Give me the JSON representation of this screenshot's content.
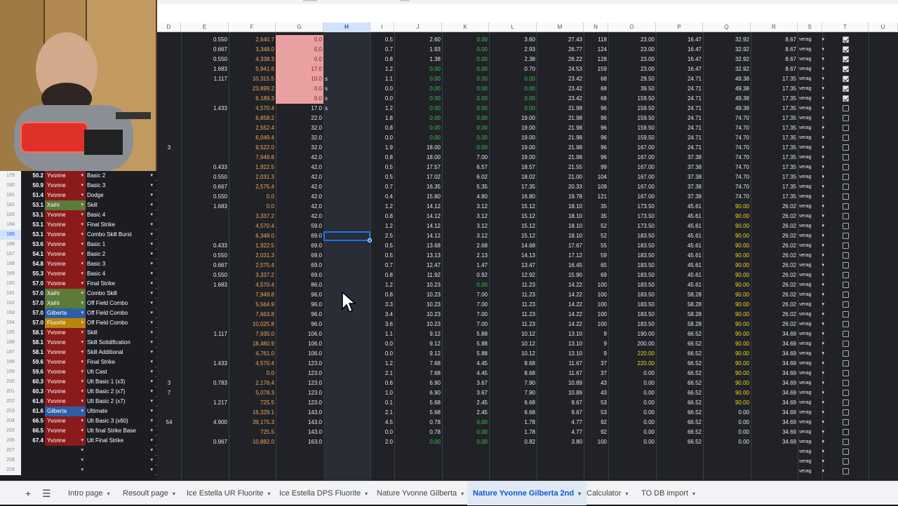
{
  "columns": [
    "D",
    "E",
    "F",
    "G",
    "H",
    "I",
    "J",
    "K",
    "L",
    "M",
    "N",
    "O",
    "P",
    "Q",
    "R",
    "S",
    "T",
    "U"
  ],
  "top_rows": [
    {
      "e": "0.550",
      "f": "2,640.7",
      "g": "0.0",
      "h": "",
      "i": "0.5",
      "j": "2.60",
      "k": "0.00",
      "l": "3.60",
      "m": "27.43",
      "n": "118",
      "o": "23.00",
      "p": "16.47",
      "q": "32.92",
      "r": "8.67",
      "t": true
    },
    {
      "e": "0.667",
      "f": "3,348.0",
      "g": "0.0",
      "h": "",
      "i": "0.7",
      "j": "1.93",
      "k": "0.00",
      "l": "2.93",
      "m": "26.77",
      "n": "124",
      "o": "23.00",
      "p": "16.47",
      "q": "32.92",
      "r": "8.67",
      "t": true
    },
    {
      "e": "0.550",
      "f": "4,338.3",
      "g": "0.0",
      "h": "",
      "i": "0.8",
      "j": "1.38",
      "k": "0.00",
      "l": "2.38",
      "m": "26.22",
      "n": "128",
      "o": "23.00",
      "p": "16.47",
      "q": "32.92",
      "r": "8.67",
      "t": true
    },
    {
      "e": "1.683",
      "f": "5,941.6",
      "g": "17.0",
      "h": "",
      "i": "1.2",
      "j": "0.00",
      "k": "0.00",
      "l": "0.70",
      "m": "24.53",
      "n": "159",
      "o": "23.00",
      "p": "16.47",
      "q": "32.92",
      "r": "8.67",
      "t": true
    },
    {
      "e": "1.117",
      "f": "10,315.5",
      "g": "10.0",
      "h": "s",
      "i": "1.1",
      "j": "0.00",
      "k": "0.00",
      "l": "0.00",
      "m": "23.42",
      "n": "68",
      "o": "29.50",
      "p": "24.71",
      "q": "49.38",
      "r": "17.35",
      "t": true
    },
    {
      "e": "",
      "f": "23,899.2",
      "g": "0.0",
      "h": "s",
      "i": "0.0",
      "j": "0.00",
      "k": "0.00",
      "l": "0.00",
      "m": "23.42",
      "n": "68",
      "o": "39.50",
      "p": "24.71",
      "q": "49.38",
      "r": "17.35",
      "t": true
    },
    {
      "e": "",
      "f": "6,189.3",
      "g": "0.0",
      "h": "s",
      "i": "0.0",
      "j": "0.00",
      "k": "0.00",
      "l": "0.00",
      "m": "23.42",
      "n": "68",
      "o": "159.50",
      "p": "24.71",
      "q": "49.38",
      "r": "17.35",
      "t": true
    },
    {
      "e": "1.433",
      "f": "4,570.4",
      "g": "17.0",
      "h": "s",
      "i": "1.2",
      "j": "0.00",
      "k": "0.00",
      "l": "0.00",
      "m": "21.98",
      "n": "96",
      "o": "159.50",
      "p": "24.71",
      "q": "49.38",
      "r": "17.35",
      "t": false
    },
    {
      "e": "",
      "f": "6,858.2",
      "g": "22.0",
      "h": "",
      "i": "1.8",
      "j": "0.00",
      "k": "0.00",
      "l": "19.00",
      "m": "21.98",
      "n": "96",
      "o": "159.50",
      "p": "24.71",
      "q": "74.70",
      "r": "17.35",
      "t": false
    },
    {
      "e": "",
      "f": "2,552.4",
      "g": "32.0",
      "h": "",
      "i": "0.8",
      "j": "0.00",
      "k": "0.00",
      "l": "19.00",
      "m": "21.98",
      "n": "96",
      "o": "159.50",
      "p": "24.71",
      "q": "74.70",
      "r": "17.35",
      "t": false
    },
    {
      "e": "",
      "f": "6,049.4",
      "g": "32.0",
      "h": "",
      "i": "0.0",
      "j": "0.00",
      "k": "0.00",
      "l": "19.00",
      "m": "21.98",
      "n": "96",
      "o": "159.50",
      "p": "24.71",
      "q": "74.70",
      "r": "17.35",
      "t": false
    },
    {
      "d": "3",
      "e": "",
      "f": "9,522.0",
      "g": "32.0",
      "h": "",
      "i": "1.9",
      "j": "18.00",
      "k": "0.00",
      "l": "19.00",
      "m": "21.98",
      "n": "96",
      "o": "167.00",
      "p": "24.71",
      "q": "74.70",
      "r": "17.35",
      "t": false
    },
    {
      "e": "",
      "f": "7,949.8",
      "g": "42.0",
      "h": "",
      "i": "0.8",
      "j": "18.00",
      "k": "7.00",
      "l": "19.00",
      "m": "21.98",
      "n": "96",
      "o": "167.00",
      "p": "37.38",
      "q": "74.70",
      "r": "17.35",
      "t": false
    },
    {
      "e": "0.433",
      "f": "1,922.5",
      "g": "42.0",
      "h": "",
      "i": "0.5",
      "j": "17.57",
      "k": "6.57",
      "l": "18.57",
      "m": "21.55",
      "n": "99",
      "o": "167.00",
      "p": "37.38",
      "q": "74.70",
      "r": "17.35",
      "t": false
    }
  ],
  "rows": [
    {
      "num": "179",
      "pct": "50.2",
      "char": "Yvonne",
      "skill": "Basic 2",
      "e": "0.550",
      "f": "2,031.3",
      "g": "42.0",
      "i": "0.5",
      "j": "17.02",
      "k": "6.02",
      "l": "18.02",
      "m": "21.00",
      "n": "104",
      "o": "167.00",
      "p": "37.38",
      "q": "74.70",
      "r": "17.35"
    },
    {
      "num": "180",
      "pct": "50.9",
      "char": "Yvonne",
      "skill": "Basic 3",
      "e": "0.667",
      "f": "2,575.4",
      "g": "42.0",
      "i": "0.7",
      "j": "16.35",
      "k": "5.35",
      "l": "17.35",
      "m": "20.33",
      "n": "109",
      "o": "167.00",
      "p": "37.38",
      "q": "74.70",
      "r": "17.35"
    },
    {
      "num": "181",
      "pct": "51.4",
      "char": "Yvonne",
      "skill": "Dodge",
      "e": "0.550",
      "f": "0.0",
      "g": "42.0",
      "i": "0.4",
      "j": "15.80",
      "k": "4.80",
      "l": "16.80",
      "m": "19.78",
      "n": "121",
      "o": "167.00",
      "p": "37.38",
      "q": "74.70",
      "r": "17.35"
    },
    {
      "num": "182",
      "pct": "53.1",
      "char": "Xaihi",
      "skill": "Skill",
      "e": "1.683",
      "f": "0.0",
      "g": "42.0",
      "i": "1.2",
      "j": "14.12",
      "k": "3.12",
      "l": "15.12",
      "m": "18.10",
      "n": "35",
      "o": "173.50",
      "p": "45.61",
      "q": "90.00",
      "r": "26.02"
    },
    {
      "num": "183",
      "pct": "53.1",
      "char": "Yvonne",
      "skill": "Basic 4",
      "e": "",
      "f": "3,337.2",
      "g": "42.0",
      "i": "0.8",
      "j": "14.12",
      "k": "3.12",
      "l": "15.12",
      "m": "18.10",
      "n": "35",
      "o": "173.50",
      "p": "45.61",
      "q": "90.00",
      "r": "26.02"
    },
    {
      "num": "184",
      "pct": "53.1",
      "char": "Yvonne",
      "skill": "Final Strike",
      "e": "",
      "f": "4,570.4",
      "g": "59.0",
      "i": "1.2",
      "j": "14.12",
      "k": "3.12",
      "l": "15.12",
      "m": "18.10",
      "n": "52",
      "o": "173.50",
      "p": "45.61",
      "q": "90.00",
      "r": "26.02"
    },
    {
      "num": "185",
      "pct": "53.1",
      "char": "Yvonne",
      "skill": "Combo Skill Burst",
      "e": "",
      "f": "6,348.0",
      "g": "69.0",
      "i": "2.5",
      "j": "14.12",
      "k": "3.12",
      "l": "15.12",
      "m": "18.10",
      "n": "52",
      "o": "183.50",
      "p": "45.61",
      "q": "90.00",
      "r": "26.02"
    },
    {
      "num": "186",
      "pct": "53.6",
      "char": "Yvonne",
      "skill": "Basic 1",
      "e": "0.433",
      "f": "1,922.5",
      "g": "69.0",
      "i": "0.5",
      "j": "13.68",
      "k": "2.68",
      "l": "14.68",
      "m": "17.67",
      "n": "55",
      "o": "183.50",
      "p": "45.61",
      "q": "90.00",
      "r": "26.02"
    },
    {
      "num": "187",
      "pct": "54.1",
      "char": "Yvonne",
      "skill": "Basic 2",
      "e": "0.550",
      "f": "2,031.3",
      "g": "69.0",
      "i": "0.5",
      "j": "13.13",
      "k": "2.13",
      "l": "14.13",
      "m": "17.12",
      "n": "59",
      "o": "183.50",
      "p": "45.61",
      "q": "90.00",
      "r": "26.02"
    },
    {
      "num": "188",
      "pct": "54.8",
      "char": "Yvonne",
      "skill": "Basic 3",
      "e": "0.667",
      "f": "2,575.4",
      "g": "69.0",
      "i": "0.7",
      "j": "12.47",
      "k": "1.47",
      "l": "13.47",
      "m": "16.45",
      "n": "65",
      "o": "183.50",
      "p": "45.61",
      "q": "90.00",
      "r": "26.02"
    },
    {
      "num": "189",
      "pct": "55.3",
      "char": "Yvonne",
      "skill": "Basic 4",
      "e": "0.550",
      "f": "3,337.2",
      "g": "69.0",
      "i": "0.8",
      "j": "11.92",
      "k": "0.92",
      "l": "12.92",
      "m": "15.90",
      "n": "69",
      "o": "183.50",
      "p": "45.61",
      "q": "90.00",
      "r": "26.02"
    },
    {
      "num": "190",
      "pct": "57.0",
      "char": "Yvonne",
      "skill": "Final Strike",
      "e": "1.683",
      "f": "4,570.4",
      "g": "86.0",
      "i": "1.2",
      "j": "10.23",
      "k": "0.00",
      "l": "11.23",
      "m": "14.22",
      "n": "100",
      "o": "183.50",
      "p": "45.61",
      "q": "90.00",
      "r": "26.02"
    },
    {
      "num": "191",
      "pct": "57.0",
      "char": "Xaihi",
      "skill": "Combo Skill",
      "e": "",
      "f": "7,949.8",
      "g": "96.0",
      "i": "0.8",
      "j": "10.23",
      "k": "7.00",
      "l": "11.23",
      "m": "14.22",
      "n": "100",
      "o": "183.50",
      "p": "58.28",
      "q": "90.00",
      "r": "26.02"
    },
    {
      "num": "192",
      "pct": "57.0",
      "char": "Xaihi",
      "skill": "Off Field Combo",
      "e": "",
      "f": "5,564.9",
      "g": "96.0",
      "i": "3.3",
      "j": "10.23",
      "k": "7.00",
      "l": "11.23",
      "m": "14.22",
      "n": "100",
      "o": "183.50",
      "p": "58.28",
      "q": "90.00",
      "r": "26.02"
    },
    {
      "num": "193",
      "pct": "57.0",
      "char": "Gilberta",
      "skill": "Off Field Combo",
      "e": "",
      "f": "7,663.8",
      "g": "96.0",
      "i": "3.4",
      "j": "10.23",
      "k": "7.00",
      "l": "11.23",
      "m": "14.22",
      "n": "100",
      "o": "183.50",
      "p": "58.28",
      "q": "90.00",
      "r": "26.02"
    },
    {
      "num": "194",
      "pct": "57.0",
      "char": "Fluorite",
      "skill": "Off Field Combo",
      "e": "",
      "f": "10,025.8",
      "g": "96.0",
      "i": "3.6",
      "j": "10.23",
      "k": "7.00",
      "l": "11.23",
      "m": "14.22",
      "n": "100",
      "o": "183.50",
      "p": "58.28",
      "q": "90.00",
      "r": "26.02"
    },
    {
      "num": "195",
      "pct": "58.1",
      "char": "Yvonne",
      "skill": "Skill",
      "e": "1.117",
      "f": "7,935.0",
      "g": "106.0",
      "i": "1.1",
      "j": "9.12",
      "k": "5.88",
      "l": "10.12",
      "m": "13.10",
      "n": "9",
      "o": "190.00",
      "p": "66.52",
      "q": "90.00",
      "r": "34.69"
    },
    {
      "num": "196",
      "pct": "58.1",
      "char": "Yvonne",
      "skill": "Skill Solidification",
      "e": "",
      "f": "18,460.9",
      "g": "106.0",
      "i": "0.0",
      "j": "9.12",
      "k": "5.88",
      "l": "10.12",
      "m": "13.10",
      "n": "9",
      "o": "200.00",
      "p": "66.52",
      "q": "90.00",
      "r": "34.69"
    },
    {
      "num": "197",
      "pct": "58.1",
      "char": "Yvonne",
      "skill": "Skill Additional",
      "e": "",
      "f": "4,761.0",
      "g": "106.0",
      "i": "0.0",
      "j": "9.12",
      "k": "5.88",
      "l": "10.12",
      "m": "13.10",
      "n": "9",
      "o": "220.00",
      "p": "66.52",
      "q": "90.00",
      "r": "34.69"
    },
    {
      "num": "198",
      "pct": "59.6",
      "char": "Yvonne",
      "skill": "Final Strike",
      "e": "1.433",
      "f": "4,570.4",
      "g": "123.0",
      "i": "1.2",
      "j": "7.68",
      "k": "4.45",
      "l": "8.68",
      "m": "11.67",
      "n": "37",
      "o": "220.00",
      "p": "66.52",
      "q": "90.00",
      "r": "34.69"
    },
    {
      "num": "199",
      "pct": "59.6",
      "char": "Yvonne",
      "skill": "Ult Cast",
      "e": "",
      "f": "0.0",
      "g": "123.0",
      "i": "2.1",
      "j": "7.68",
      "k": "4.45",
      "l": "8.68",
      "m": "11.67",
      "n": "37",
      "o": "0.00",
      "p": "66.52",
      "q": "90.00",
      "r": "34.69"
    },
    {
      "num": "200",
      "pct": "60.3",
      "char": "Yvonne",
      "skill": "Ult Basic 1 (x3)",
      "d": "3",
      "e": "0.783",
      "f": "2,176.4",
      "g": "123.0",
      "i": "0.6",
      "j": "6.90",
      "k": "3.67",
      "l": "7.90",
      "m": "10.89",
      "n": "43",
      "o": "0.00",
      "p": "66.52",
      "q": "90.00",
      "r": "34.69"
    },
    {
      "num": "201",
      "pct": "60.3",
      "char": "Yvonne",
      "skill": "Ult Basic 2 (x7)",
      "d": "7",
      "e": "",
      "f": "5,078.3",
      "g": "123.0",
      "i": "1.0",
      "j": "6.90",
      "k": "3.67",
      "l": "7.90",
      "m": "10.89",
      "n": "43",
      "o": "0.00",
      "p": "66.52",
      "q": "90.00",
      "r": "34.69"
    },
    {
      "num": "202",
      "pct": "61.6",
      "char": "Yvonne",
      "skill": "Ult Basic 2 (x7)",
      "e": "1.217",
      "f": "725.5",
      "g": "123.0",
      "i": "0.1",
      "j": "5.68",
      "k": "2.45",
      "l": "6.68",
      "m": "9.67",
      "n": "53",
      "o": "0.00",
      "p": "66.52",
      "q": "90.00",
      "r": "34.69"
    },
    {
      "num": "203",
      "pct": "61.6",
      "char": "Gilberta",
      "skill": "Ultimate",
      "e": "",
      "f": "16,329.1",
      "g": "143.0",
      "i": "2.1",
      "j": "5.68",
      "k": "2.45",
      "l": "6.68",
      "m": "9.67",
      "n": "53",
      "o": "0.00",
      "p": "66.52",
      "q": "0.00",
      "r": "34.69"
    },
    {
      "num": "204",
      "pct": "66.5",
      "char": "Yvonne",
      "skill": "Ult Basic 3 (x60)",
      "d": "54",
      "e": "4.900",
      "f": "39,175.3",
      "g": "143.0",
      "i": "4.5",
      "j": "0.78",
      "k": "0.00",
      "l": "1.78",
      "m": "4.77",
      "n": "92",
      "o": "0.00",
      "p": "66.52",
      "q": "0.00",
      "r": "34.69"
    },
    {
      "num": "205",
      "pct": "66.5",
      "char": "Yvonne",
      "skill": "Ult final Strike Base",
      "e": "",
      "f": "725.5",
      "g": "143.0",
      "i": "0.0",
      "j": "0.78",
      "k": "0.00",
      "l": "1.78",
      "m": "4.77",
      "n": "92",
      "o": "0.00",
      "p": "66.52",
      "q": "0.00",
      "r": "34.69"
    },
    {
      "num": "206",
      "pct": "67.4",
      "char": "Yvonne",
      "skill": "Ult Final Strike",
      "e": "0.967",
      "f": "10,882.0",
      "g": "163.0",
      "i": "2.0",
      "j": "0.00",
      "k": "0.00",
      "l": "0.82",
      "m": "3.80",
      "n": "100",
      "o": "0.00",
      "p": "66.52",
      "q": "0.00",
      "r": "34.69"
    },
    {
      "num": "207",
      "pct": "",
      "char": "",
      "skill": ""
    },
    {
      "num": "208",
      "pct": "",
      "char": "",
      "skill": ""
    },
    {
      "num": "209",
      "pct": "",
      "char": "",
      "skill": ""
    }
  ],
  "s_dropdown_label": "verag",
  "char_colors": {
    "Yvonne": "#8b1a1a",
    "Xaihi": "#5c7a3a",
    "Gilberta": "#2e5ea8",
    "Fluorite": "#b8860b"
  },
  "tabs": [
    {
      "label": "Intro page",
      "active": false
    },
    {
      "label": "Resoult page",
      "active": false
    },
    {
      "label": "Ice Estella UR Fluorite",
      "active": false
    },
    {
      "label": "Ice Estella DPS Fluorite",
      "active": false
    },
    {
      "label": "Nature Yvonne Gilberta",
      "active": false
    },
    {
      "label": "Nature Yvonne Gilberta 2nd",
      "active": true
    },
    {
      "label": "Calculator",
      "active": false
    },
    {
      "label": "TO DB import",
      "active": false
    }
  ],
  "icons": {
    "add": "plus-icon",
    "menu": "menu-icon"
  }
}
